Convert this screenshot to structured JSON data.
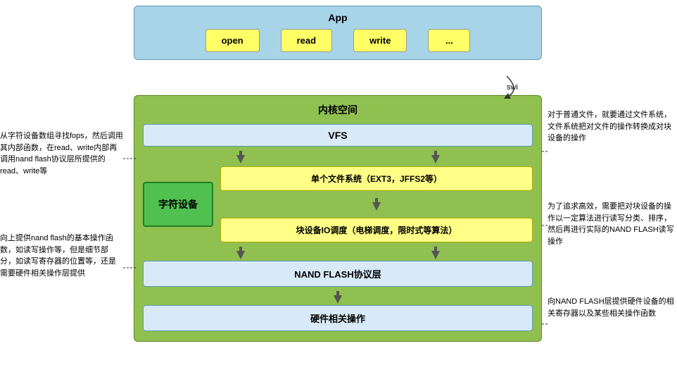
{
  "app": {
    "title": "App",
    "buttons": [
      "open",
      "read",
      "write",
      "..."
    ]
  },
  "kernel": {
    "title": "内核空间",
    "vfs": "VFS",
    "char_device": "字符设备",
    "fs_box": "单个文件系统（EXT3，JFFS2等）",
    "io_box": "块设备IO调度（电梯调度，限时式等算法）",
    "nand_protocol": "NAND FLASH协议层",
    "hw_ops": "硬件相关操作"
  },
  "annotations": {
    "swi": "swi",
    "left_top": "从字符设备数组寻找fops，然后调用其内部函数，在read、write内部再调用nand flash协议层所提供的read、write等",
    "left_bottom": "向上提供nand flash的基本操作函数，如读写操作等，但是细节部分，如读写寄存器的位置等，还是需要硬件相关操作层提供",
    "right_top": "对于普通文件，就要通过文件系统，文件系统把对文件的操作转换成对块设备的操作",
    "right_middle": "为了追求高效，需要把对块设备的操作以一定算法进行读写分类、排序，然后再进行实际的NAND FLASH读写操作",
    "right_bottom": "向NAND FLASH层提供硬件设备的相关寄存器以及某些相关操作函数"
  }
}
